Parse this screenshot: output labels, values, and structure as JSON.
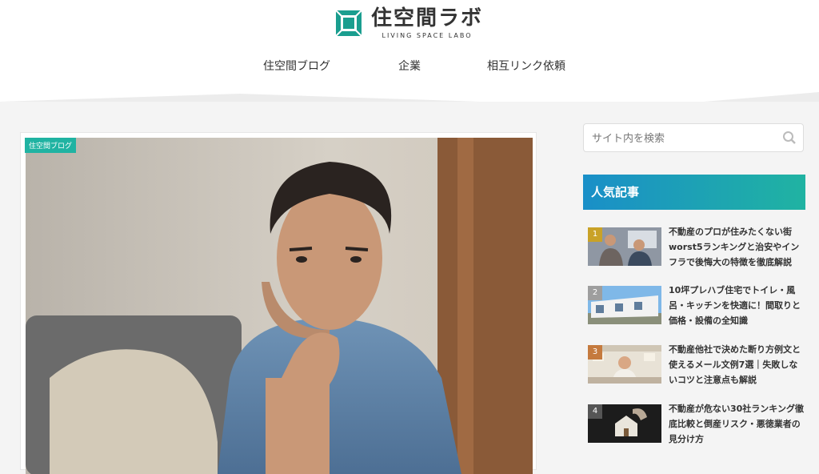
{
  "header": {
    "logo_title": "住空間ラボ",
    "logo_sub": "LIVING SPACE LABO",
    "nav": [
      "住空間ブログ",
      "企業",
      "相互リンク依頼"
    ]
  },
  "article": {
    "category": "住空間ブログ"
  },
  "sidebar": {
    "search_placeholder": "サイト内を検索",
    "popular_title": "人気記事",
    "popular": [
      {
        "rank": "1",
        "title": "不動産のプロが住みたくない街worst5ランキングと治安やインフラで後悔大の特徴を徹底解説"
      },
      {
        "rank": "2",
        "title": "10坪プレハブ住宅でトイレ・風呂・キッチンを快適に！間取りと価格・設備の全知識"
      },
      {
        "rank": "3",
        "title": "不動産他社で決めた断り方例文と使えるメール文例7選｜失敗しないコツと注意点も解説"
      },
      {
        "rank": "4",
        "title": "不動産が危ない30社ランキング徹底比較と倒産リスク・悪徳業者の見分け方"
      }
    ]
  },
  "colors": {
    "accent": "#20b3a2",
    "rank_gold": "#c9a227",
    "rank_gray": "#9e9e9e",
    "rank_bronze": "#c57a3e"
  }
}
